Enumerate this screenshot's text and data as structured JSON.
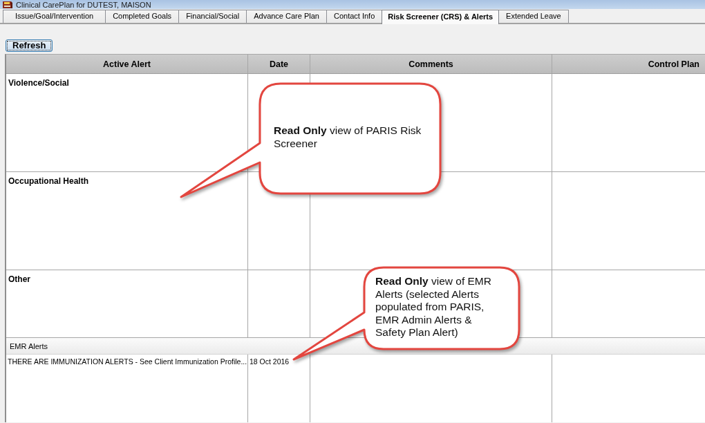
{
  "window": {
    "title": "Clinical CarePlan for DUTEST, MAISON"
  },
  "tabs": [
    {
      "label": "Issue/Goal/Intervention",
      "selected": false
    },
    {
      "label": "Completed Goals",
      "selected": false
    },
    {
      "label": "Financial/Social",
      "selected": false
    },
    {
      "label": "Advance Care Plan",
      "selected": false
    },
    {
      "label": "Contact Info",
      "selected": false
    },
    {
      "label": "Risk Screener (CRS) & Alerts",
      "selected": true
    },
    {
      "label": "Extended Leave",
      "selected": false
    }
  ],
  "refresh_button": {
    "label": "Refresh"
  },
  "table": {
    "columns": [
      "Active Alert",
      "Date",
      "Comments",
      "Control Plan"
    ],
    "rows": [
      {
        "active_alert": "Violence/Social"
      },
      {
        "active_alert": "Occupational Health"
      },
      {
        "active_alert": "Other"
      }
    ],
    "groups": [
      {
        "title": "EMR Alerts",
        "rows": [
          {
            "active_alert": "THERE ARE IMMUNIZATION ALERTS - See Client Immunization Profile...",
            "date": "18 Oct 2016"
          }
        ]
      }
    ]
  },
  "callouts": [
    {
      "text": "**Read Only** view of PARIS Risk Screener"
    },
    {
      "text": "**Read Only** view of EMR Alerts (selected Alerts populated from PARIS, EMR Admin Alerts & Safety Plan Alert)"
    }
  ]
}
